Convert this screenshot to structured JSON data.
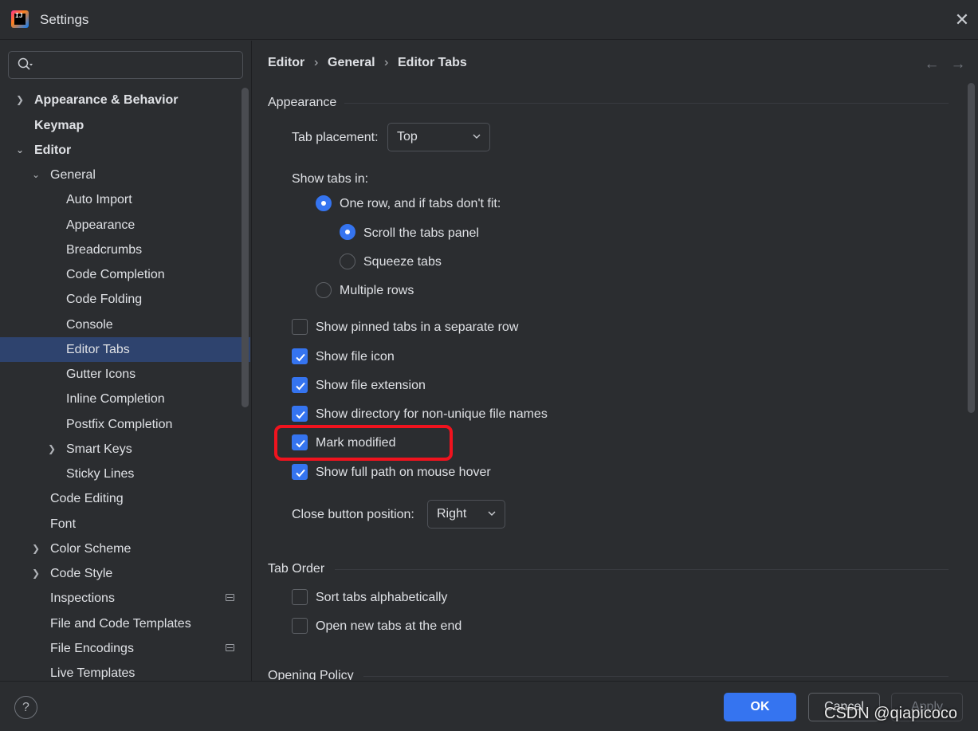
{
  "window": {
    "logo_text": "IJ",
    "title": "Settings",
    "close_glyph": "✕"
  },
  "search": {
    "value": "",
    "placeholder": ""
  },
  "tree": [
    {
      "label": "Appearance & Behavior",
      "chevron": "right",
      "bold": true
    },
    {
      "label": "Keymap",
      "bold": true
    },
    {
      "label": "Editor",
      "chevron": "down",
      "bold": true
    },
    {
      "label": "General",
      "chevron": "down"
    },
    {
      "label": "Auto Import"
    },
    {
      "label": "Appearance"
    },
    {
      "label": "Breadcrumbs"
    },
    {
      "label": "Code Completion"
    },
    {
      "label": "Code Folding"
    },
    {
      "label": "Console"
    },
    {
      "label": "Editor Tabs",
      "selected": true
    },
    {
      "label": "Gutter Icons"
    },
    {
      "label": "Inline Completion"
    },
    {
      "label": "Postfix Completion"
    },
    {
      "label": "Smart Keys",
      "chevron": "right"
    },
    {
      "label": "Sticky Lines"
    },
    {
      "label": "Code Editing"
    },
    {
      "label": "Font"
    },
    {
      "label": "Color Scheme",
      "chevron": "right"
    },
    {
      "label": "Code Style",
      "chevron": "right"
    },
    {
      "label": "Inspections",
      "badge": "window-icon"
    },
    {
      "label": "File and Code Templates"
    },
    {
      "label": "File Encodings",
      "badge": "window-icon"
    },
    {
      "label": "Live Templates"
    }
  ],
  "breadcrumb": {
    "items": [
      "Editor",
      "General",
      "Editor Tabs"
    ],
    "separator": "›",
    "back_glyph": "←",
    "forward_glyph": "→"
  },
  "appearance": {
    "title": "Appearance",
    "tab_placement_label": "Tab placement:",
    "tab_placement_value": "Top",
    "show_tabs_in_label": "Show tabs in:",
    "radio_one_row": "One row, and if tabs don't fit:",
    "radio_scroll": "Scroll the tabs panel",
    "radio_squeeze": "Squeeze tabs",
    "radio_multiple": "Multiple rows",
    "selected_mode": "one_row",
    "selected_overflow": "scroll",
    "checkboxes": [
      {
        "label": "Show pinned tabs in a separate row",
        "checked": false
      },
      {
        "label": "Show file icon",
        "checked": true
      },
      {
        "label": "Show file extension",
        "checked": true
      },
      {
        "label": "Show directory for non-unique file names",
        "checked": true
      },
      {
        "label": "Mark modified",
        "checked": true
      },
      {
        "label": "Show full path on mouse hover",
        "checked": true
      }
    ],
    "close_button_label": "Close button position:",
    "close_button_value": "Right"
  },
  "tab_order": {
    "title": "Tab Order",
    "checkboxes": [
      {
        "label": "Sort tabs alphabetically",
        "checked": false
      },
      {
        "label": "Open new tabs at the end",
        "checked": false
      }
    ]
  },
  "opening_policy": {
    "title": "Opening Policy"
  },
  "footer": {
    "help_glyph": "?",
    "ok_label": "OK",
    "cancel_label": "Cancel",
    "apply_label": "Apply"
  },
  "watermark": "CSDN @qiapicoco",
  "colors": {
    "background": "#2b2d30",
    "accent": "#3574f0",
    "selection": "#2e436e",
    "highlight": "#f0131e"
  }
}
